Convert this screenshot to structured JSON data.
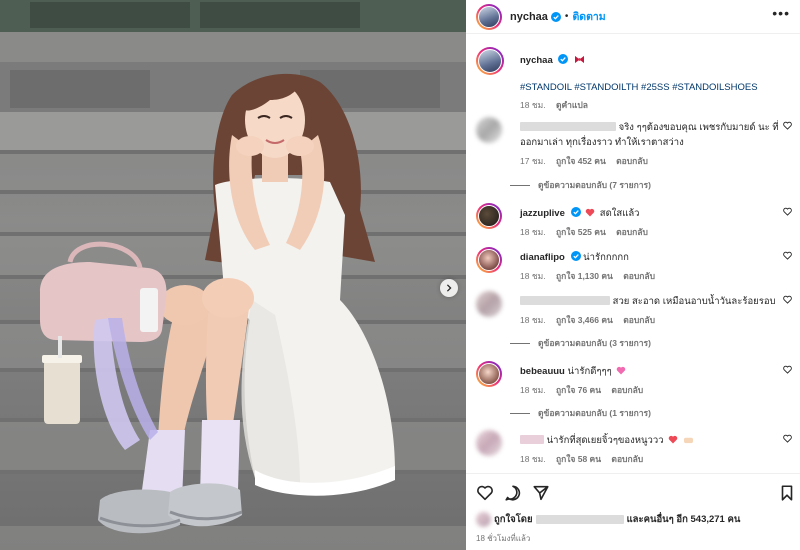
{
  "post": {
    "username": "nychaa",
    "follow_label": "ติดตาม",
    "more_label": "•••"
  },
  "caption": {
    "username": "nychaa",
    "hashtags": "#STANDOIL #STANDOILTH #25SS #STANDOILSHOES",
    "time": "18 ชม.",
    "translate": "ดูคำแปล"
  },
  "comments": [
    {
      "text": "จริง ๆๆต้องขอบคุณ เพชรกับมายด์ นะ ที่ออกมาเล่า ทุกเรื่องราว ทำให้เราตาสว่าง",
      "time": "17 ชม.",
      "likes": "ถูกใจ 452 คน",
      "reply": "ตอบกลับ",
      "view_replies": "ดูข้อความตอบกลับ (7 รายการ)"
    },
    {
      "username": "jazzuplive",
      "text": "สดใสแล้ว",
      "time": "18 ชม.",
      "likes": "ถูกใจ 525 คน",
      "reply": "ตอบกลับ"
    },
    {
      "username": "dianaflipo",
      "text": "น่ารักกกกก",
      "time": "18 ชม.",
      "likes": "ถูกใจ 1,130 คน",
      "reply": "ตอบกลับ"
    },
    {
      "text": "สวย สะอาด เหมือนอาบน้ำวันละร้อยรอบ",
      "time": "18 ชม.",
      "likes": "ถูกใจ 3,466 คน",
      "reply": "ตอบกลับ",
      "view_replies": "ดูข้อความตอบกลับ (3 รายการ)"
    },
    {
      "username": "bebeauuu",
      "text": "น่ารักดีๆๆๆ",
      "time": "18 ชม.",
      "likes": "ถูกใจ 76 คน",
      "reply": "ตอบกลับ",
      "view_replies": "ดูข้อความตอบกลับ (1 รายการ)"
    },
    {
      "text": "น่ารักที่สุดเยยจิ้วๆของหนูววว",
      "time": "18 ชม.",
      "likes": "ถูกใจ 58 คน",
      "reply": "ตอบกลับ"
    }
  ],
  "footer": {
    "liked_by_prefix": "ถูกใจโดย",
    "liked_by_suffix": "และคนอื่นๆ อีก 543,271 คน",
    "time": "18 ชั่วโมงที่แล้ว"
  },
  "icons": {
    "verified": "verified-badge-icon",
    "heart": "heart-icon",
    "comment": "comment-icon",
    "share": "share-icon",
    "save": "bookmark-icon",
    "next": "chevron-right-icon"
  },
  "colors": {
    "link": "#00376b",
    "follow": "#0095f6",
    "verified": "#0095f6",
    "heart_red": "#ed4956"
  }
}
